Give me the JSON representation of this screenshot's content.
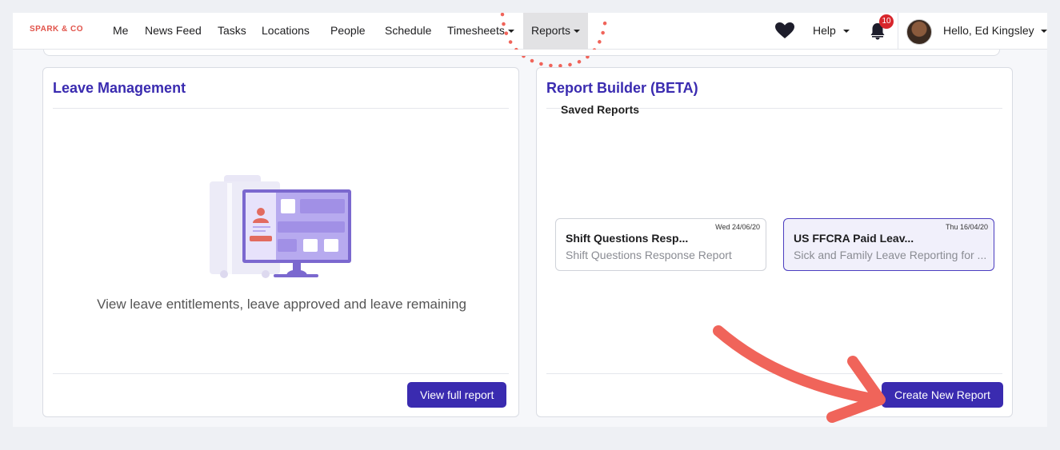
{
  "nav": {
    "brand": "SPARK & CO",
    "items": [
      {
        "label": "Me"
      },
      {
        "label": "News Feed"
      },
      {
        "label": "Tasks"
      },
      {
        "label": "Locations"
      },
      {
        "label": "People"
      },
      {
        "label": "Schedule"
      },
      {
        "label": "Timesheets"
      },
      {
        "label": "Reports"
      }
    ],
    "help": "Help",
    "notification_count": "10",
    "greeting": "Hello, Ed Kingsley",
    "icons": [
      "heart-icon",
      "bell-icon",
      "avatar"
    ]
  },
  "leave": {
    "title": "Leave Management",
    "description": "View leave entitlements, leave approved and leave remaining",
    "button": "View full report"
  },
  "builder": {
    "title": "Report Builder (BETA)",
    "saved_label": "Saved Reports",
    "reports": [
      {
        "date": "Wed 24/06/20",
        "title": "Shift Questions Resp...",
        "subtitle": "Shift Questions Response Report"
      },
      {
        "date": "Thu 16/04/20",
        "title": "US FFCRA Paid Leav...",
        "subtitle": "Sick and Family Leave Reporting for ..."
      }
    ],
    "button": "Create New Report"
  },
  "colors": {
    "accent": "#3a2bb0",
    "brand": "#e1534a",
    "annotation": "#f0645a"
  }
}
